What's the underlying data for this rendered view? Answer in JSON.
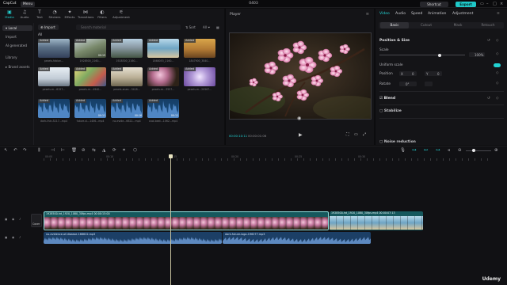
{
  "titlebar": {
    "app_name": "CapCut",
    "menu_label": "Menu",
    "project_name": "0403",
    "shortcut_label": "Shortcut",
    "export_label": "Export"
  },
  "media_tabs": [
    {
      "label": "Media",
      "icon": "media-icon",
      "active": true
    },
    {
      "label": "Audio",
      "icon": "audio-icon"
    },
    {
      "label": "Text",
      "icon": "text-icon"
    },
    {
      "label": "Stickers",
      "icon": "stickers-icon"
    },
    {
      "label": "Effects",
      "icon": "effects-icon"
    },
    {
      "label": "Transitions",
      "icon": "transitions-icon"
    },
    {
      "label": "Filters",
      "icon": "filters-icon"
    },
    {
      "label": "Adjustment",
      "icon": "adjustment-icon"
    }
  ],
  "left_nav": [
    {
      "label": "Local",
      "active": true
    },
    {
      "label": "Import"
    },
    {
      "label": "AI generated"
    },
    {
      "label": "Library"
    },
    {
      "label": "Brand assets"
    }
  ],
  "media": {
    "import_label": "Import",
    "search_placeholder": "Search material",
    "sort_label": "Sort",
    "filter_label": "All",
    "all_label": "All",
    "added_label": "Added",
    "items": [
      {
        "caption": "pexels-fabian...",
        "duration": "",
        "kind": "mountains"
      },
      {
        "caption": "1928500_2160...",
        "duration": "00:15",
        "kind": "road"
      },
      {
        "caption": "1928300_2160...",
        "duration": "",
        "kind": "coast"
      },
      {
        "caption": "1868053_2160...",
        "duration": "",
        "kind": "beach"
      },
      {
        "caption": "1847900_3840...",
        "duration": "",
        "kind": "desert"
      },
      {
        "caption": "pexels-m...6157...",
        "duration": "",
        "kind": "door"
      },
      {
        "caption": "pexels-m...4940...",
        "duration": "",
        "kind": "art"
      },
      {
        "caption": "pexels-anan...3418...",
        "duration": "",
        "kind": "building"
      },
      {
        "caption": "pexels-m...3557...",
        "duration": "",
        "kind": "flowers"
      },
      {
        "caption": "pexels-m...20567...",
        "duration": "",
        "kind": "purple"
      },
      {
        "caption": "dark-thin-5217...mp4",
        "duration": "",
        "kind": "audio"
      },
      {
        "caption": "future-vl...1406...mp4",
        "duration": "00:11",
        "kind": "audio"
      },
      {
        "caption": "no-evide...6622...mp4",
        "duration": "00:16",
        "kind": "audio"
      },
      {
        "caption": "cool-beat...1062...mp4",
        "duration": "00:11",
        "kind": "audio"
      }
    ]
  },
  "player": {
    "title": "Player",
    "time_current": "00:00:10:11",
    "time_total": "00:00:01:06"
  },
  "inspector": {
    "tabs": [
      "Video",
      "Audio",
      "Speed",
      "Animation",
      "Adjustment"
    ],
    "subtabs": [
      "Basic",
      "Cutout",
      "Mask",
      "Retouch"
    ],
    "position_size": "Position & Size",
    "scale_label": "Scale",
    "scale_value": "100%",
    "scale_fraction": 0.7,
    "uniform_scale_label": "Uniform scale",
    "position_label": "Position",
    "pos_x_label": "X",
    "pos_x": "0",
    "pos_y_label": "Y",
    "pos_y": "0",
    "rotate_label": "Rotate",
    "rotate_value": "0°",
    "blend_label": "Blend",
    "stabilize_label": "Stabilize",
    "noise_label": "Noise reduction"
  },
  "timeline": {
    "ticks": [
      "00:00",
      "00:10",
      "00:15",
      "00:20",
      "00:25",
      "00:30"
    ],
    "cover_label": "Cover",
    "video_clip1": "1928500-hd_1920_1080_30fps.mp4  00:00:15:00",
    "video_clip2": "1928500-hd_1920_1080_30fps.mp4  00:00:07:13",
    "audio_clip1": "no-evidence-of-disease-166622.mp3",
    "audio_clip2": "dark-future-logo-196277.mp3"
  },
  "watermark": "Udemy",
  "colors": {
    "accent": "#22d3d3",
    "video_clip": "#16585d",
    "audio_clip": "#1c3f66"
  }
}
